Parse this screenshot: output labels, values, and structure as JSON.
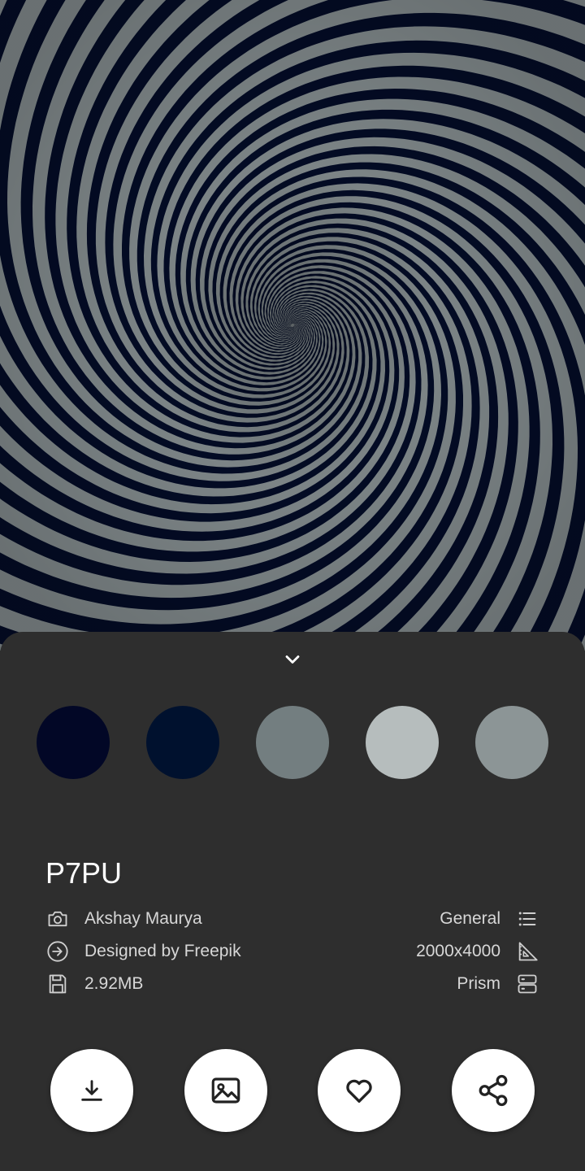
{
  "wallpaper": {
    "name": "P7PU",
    "author": "Akshay Maurya",
    "credit": "Designed by Freepik",
    "size": "2.92MB",
    "category": "General",
    "resolution": "2000x4000",
    "provider": "Prism"
  },
  "palette": [
    "#020726",
    "#00112e",
    "#737e80",
    "#b6bdbd",
    "#8c9596"
  ],
  "icons": {
    "collapse": "chevron-down-icon",
    "author": "camera-icon",
    "credit": "arrow-circle-right-icon",
    "size": "save-icon",
    "category": "list-icon",
    "resolution": "set-square-icon",
    "provider": "storage-icon",
    "download": "download-icon",
    "set_wallpaper": "image-icon",
    "favorite": "heart-icon",
    "share": "share-icon"
  }
}
